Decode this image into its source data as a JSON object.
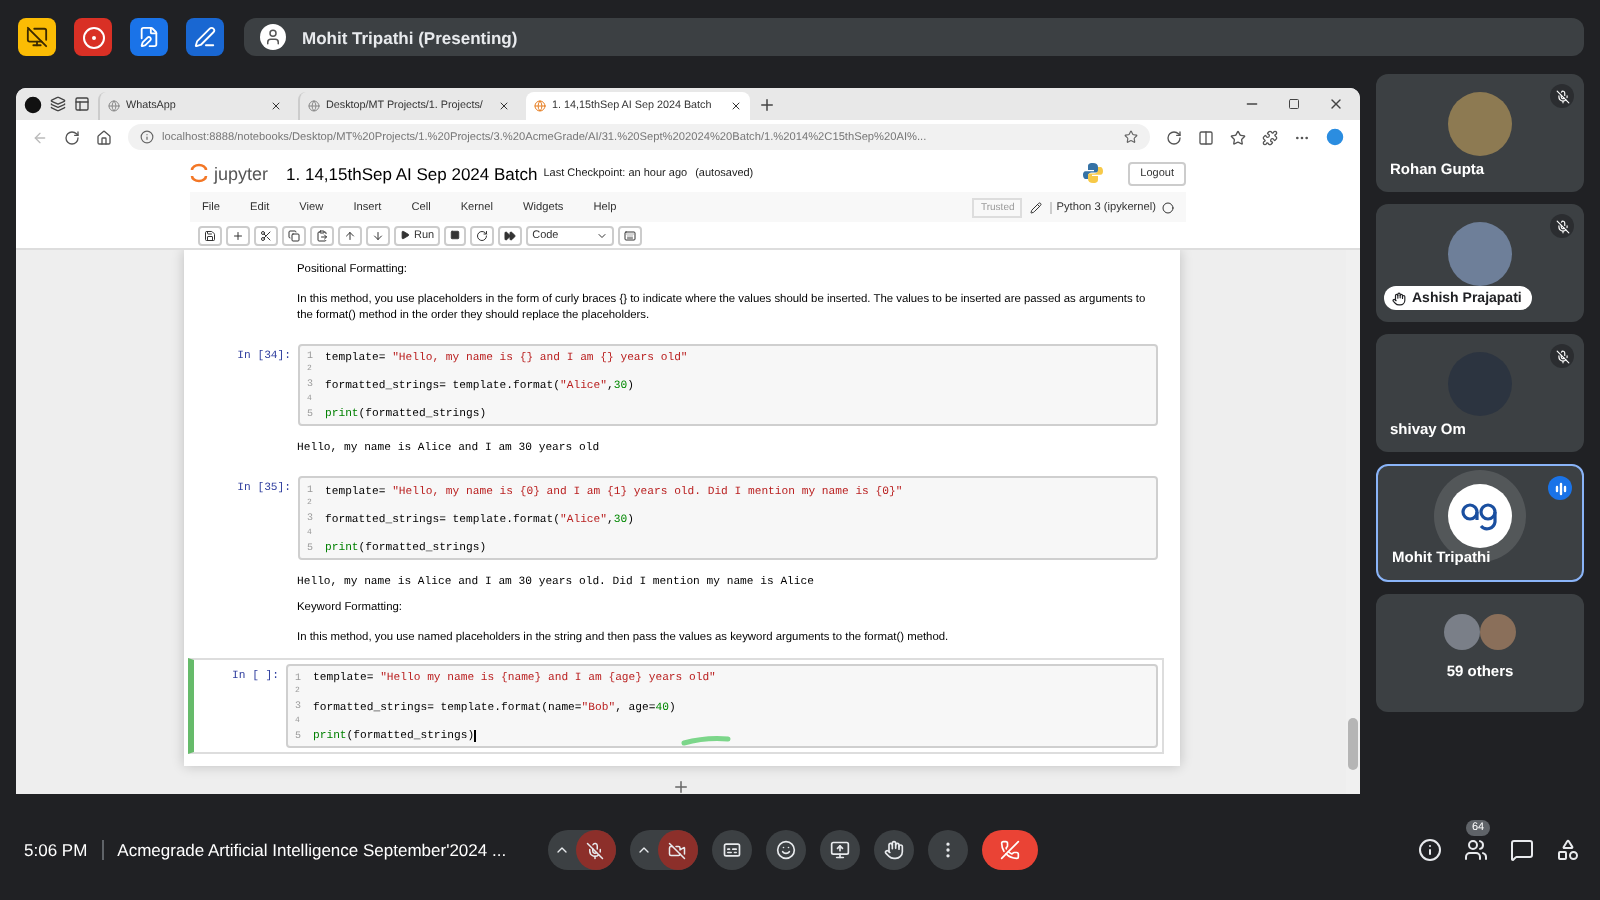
{
  "top_bar": {
    "presenter_label": "Mohit Tripathi (Presenting)"
  },
  "browser": {
    "tabs": [
      {
        "title": "WhatsApp",
        "selected": false
      },
      {
        "title": "Desktop/MT Projects/1. Projects/",
        "selected": false
      },
      {
        "title": "1. 14,15thSep AI Sep 2024 Batch",
        "selected": true
      }
    ],
    "address": "localhost:8888/notebooks/Desktop/MT%20Projects/1.%20Projects/3.%20AcmeGrade/AI/31.%20Sept%202024%20Batch/1.%2014%2C15thSep%20AI%..."
  },
  "notebook": {
    "logo_text": "jupyter",
    "title": "1. 14,15thSep AI Sep 2024 Batch",
    "checkpoint": "Last Checkpoint: an hour ago",
    "autosave": "(autosaved)",
    "logout": "Logout",
    "menu": [
      "File",
      "Edit",
      "View",
      "Insert",
      "Cell",
      "Kernel",
      "Widgets",
      "Help"
    ],
    "trusted": "Trusted",
    "kernel": "Python 3 (ipykernel)",
    "run_label": "Run",
    "cell_type": "Code",
    "cells": [
      {
        "kind": "markdown",
        "paragraphs": [
          "Positional Formatting:",
          "In this method, you use placeholders in the form of curly braces {} to indicate where the values should be inserted. The values to be inserted are passed as arguments to the format() method in the order they should replace the placeholders."
        ]
      },
      {
        "kind": "code",
        "prompt": "In [34]:",
        "active": false,
        "lines": [
          {
            "number": "1",
            "tokens": [
              {
                "text": "template= ",
                "kind": "plain"
              },
              {
                "text": "\"Hello, my name is {} and I am {} years old\"",
                "kind": "string"
              }
            ]
          },
          {
            "number": "2"
          },
          {
            "number": "3",
            "tokens": [
              {
                "text": "formatted_strings= template.format(",
                "kind": "plain"
              },
              {
                "text": "\"Alice\"",
                "kind": "string"
              },
              {
                "text": ",",
                "kind": "plain"
              },
              {
                "text": "30",
                "kind": "number"
              },
              {
                "text": ")",
                "kind": "plain"
              }
            ]
          },
          {
            "number": "4"
          },
          {
            "number": "5",
            "tokens": [
              {
                "text": "print",
                "kind": "builtin"
              },
              {
                "text": "(formatted_strings)",
                "kind": "plain"
              }
            ]
          }
        ],
        "output": "Hello, my name is Alice and I am 30 years old"
      },
      {
        "kind": "code",
        "prompt": "In [35]:",
        "active": false,
        "lines": [
          {
            "number": "1",
            "tokens": [
              {
                "text": "template= ",
                "kind": "plain"
              },
              {
                "text": "\"Hello, my name is {0} and I am {1} years old. Did I mention my name is {0}\"",
                "kind": "string"
              }
            ]
          },
          {
            "number": "2"
          },
          {
            "number": "3",
            "tokens": [
              {
                "text": "formatted_strings= template.format(",
                "kind": "plain"
              },
              {
                "text": "\"Alice\"",
                "kind": "string"
              },
              {
                "text": ",",
                "kind": "plain"
              },
              {
                "text": "30",
                "kind": "number"
              },
              {
                "text": ")",
                "kind": "plain"
              }
            ]
          },
          {
            "number": "4"
          },
          {
            "number": "5",
            "tokens": [
              {
                "text": "print",
                "kind": "builtin"
              },
              {
                "text": "(formatted_strings)",
                "kind": "plain"
              }
            ]
          }
        ],
        "output": "Hello, my name is Alice and I am 30 years old. Did I mention my name is Alice"
      },
      {
        "kind": "markdown",
        "paragraphs": [
          "Keyword Formatting:",
          "In this method, you use named placeholders in the string and then pass the values as keyword arguments to the format() method."
        ]
      },
      {
        "kind": "code",
        "prompt": "In [ ]:",
        "active": true,
        "lines": [
          {
            "number": "1",
            "tokens": [
              {
                "text": "template= ",
                "kind": "plain"
              },
              {
                "text": "\"Hello my name is {name} and I am {age} years old\"",
                "kind": "string"
              }
            ]
          },
          {
            "number": "2"
          },
          {
            "number": "3",
            "tokens": [
              {
                "text": "formatted_strings= template.format(name=",
                "kind": "plain"
              },
              {
                "text": "\"Bob\"",
                "kind": "string"
              },
              {
                "text": ", age=",
                "kind": "plain"
              },
              {
                "text": "40",
                "kind": "number"
              },
              {
                "text": ")",
                "kind": "plain"
              }
            ]
          },
          {
            "number": "4"
          },
          {
            "number": "5",
            "cursor": true,
            "tokens": [
              {
                "text": "print",
                "kind": "builtin"
              },
              {
                "text": "(formatted_strings)",
                "kind": "plain"
              }
            ]
          }
        ]
      }
    ]
  },
  "participants": [
    {
      "name": "Rohan Gupta",
      "kind": "photo",
      "muted": true,
      "hand_raised": false,
      "speaking": false,
      "selected": false
    },
    {
      "name": "Ashish Prajapati",
      "kind": "photo",
      "muted": true,
      "hand_raised": true,
      "speaking": false,
      "selected": false
    },
    {
      "name": "shivay Om",
      "kind": "photo",
      "muted": true,
      "hand_raised": false,
      "speaking": false,
      "selected": false
    },
    {
      "name": "Mohit Tripathi",
      "kind": "logo",
      "muted": false,
      "hand_raised": false,
      "speaking": true,
      "selected": true
    }
  ],
  "others": {
    "label": "59 others"
  },
  "bottom_bar": {
    "time": "5:06 PM",
    "meeting_title": "Acmegrade Artificial Intelligence September'2024 ...",
    "mic_muted": true,
    "camera_off": true,
    "people_count": "64"
  }
}
